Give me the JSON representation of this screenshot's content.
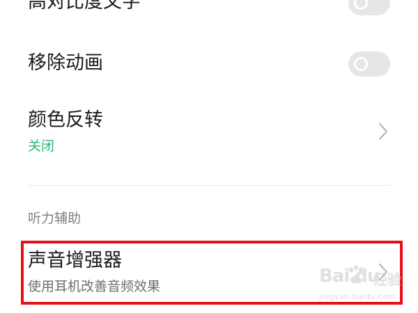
{
  "settings": {
    "high_contrast_text": {
      "title": "高对比度文字",
      "enabled": false
    },
    "remove_animations": {
      "title": "移除动画",
      "enabled": false
    },
    "color_inversion": {
      "title": "颜色反转",
      "status": "关闭"
    },
    "hearing_section": {
      "header": "听力辅助"
    },
    "sound_amplifier": {
      "title": "声音增强器",
      "subtitle": "使用耳机改善音频效果"
    }
  },
  "watermark": {
    "logo": "Bai  du",
    "suffix": "经验",
    "url": "jingyan.baidu.com"
  },
  "colors": {
    "accent_green": "#2bb673",
    "highlight_red": "#e3101a",
    "toggle_off": "#e6e6e6",
    "chevron": "#b8b8b8"
  }
}
